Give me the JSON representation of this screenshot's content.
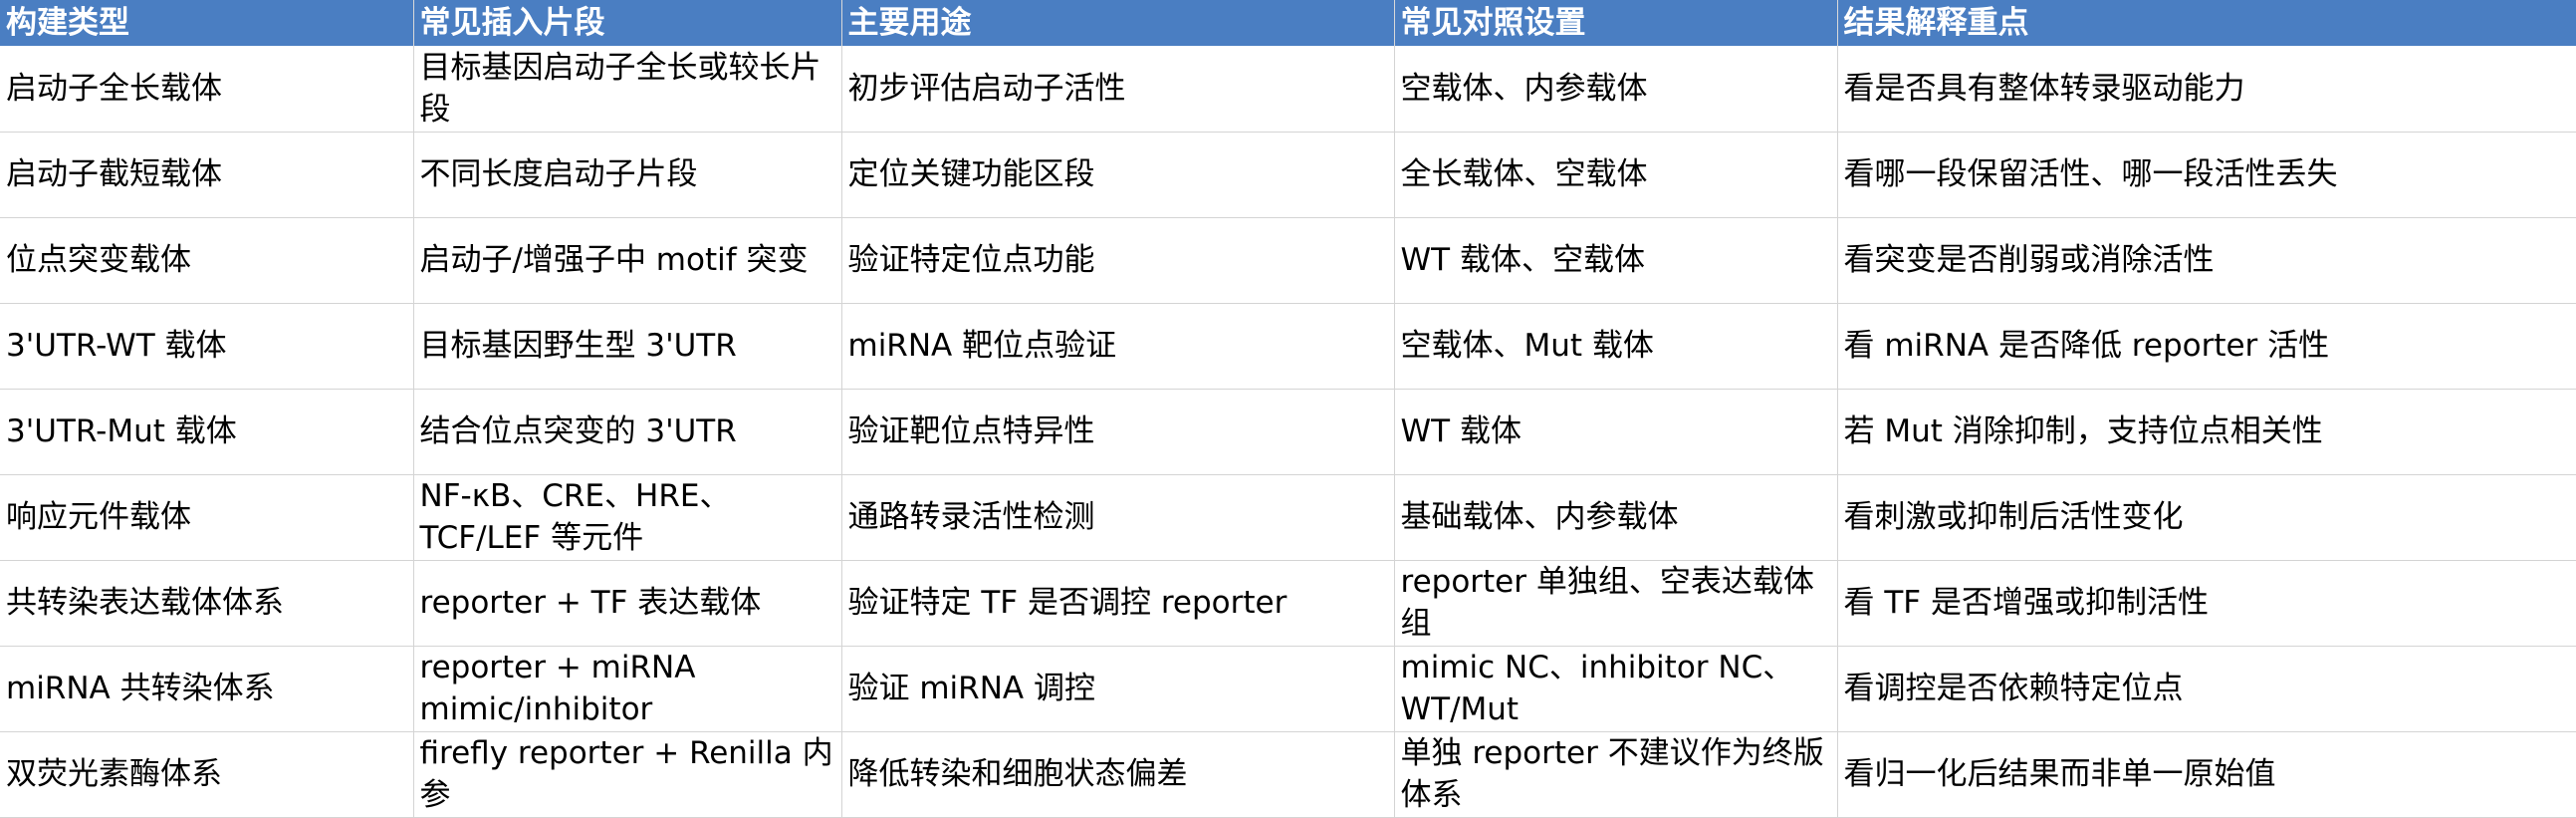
{
  "table": {
    "headers": [
      "构建类型",
      "常见插入片段",
      "主要用途",
      "常见对照设置",
      "结果解释重点"
    ],
    "rows": [
      [
        "启动子全长载体",
        "目标基因启动子全长或较长片段",
        "初步评估启动子活性",
        "空载体、内参载体",
        "看是否具有整体转录驱动能力"
      ],
      [
        "启动子截短载体",
        "不同长度启动子片段",
        "定位关键功能区段",
        "全长载体、空载体",
        "看哪一段保留活性、哪一段活性丢失"
      ],
      [
        "位点突变载体",
        "启动子/增强子中 motif 突变",
        "验证特定位点功能",
        "WT 载体、空载体",
        "看突变是否削弱或消除活性"
      ],
      [
        "3'UTR-WT 载体",
        "目标基因野生型 3'UTR",
        "miRNA 靶位点验证",
        "空载体、Mut 载体",
        "看 miRNA 是否降低 reporter 活性"
      ],
      [
        "3'UTR-Mut 载体",
        "结合位点突变的 3'UTR",
        "验证靶位点特异性",
        "WT 载体",
        "若 Mut 消除抑制，支持位点相关性"
      ],
      [
        "响应元件载体",
        "NF-κB、CRE、HRE、TCF/LEF 等元件",
        "通路转录活性检测",
        "基础载体、内参载体",
        "看刺激或抑制后活性变化"
      ],
      [
        "共转染表达载体体系",
        "reporter + TF 表达载体",
        "验证特定 TF 是否调控 reporter",
        "reporter 单独组、空表达载体组",
        "看 TF 是否增强或抑制活性"
      ],
      [
        "miRNA 共转染体系",
        "reporter + miRNA mimic/inhibitor",
        "验证 miRNA 调控",
        "mimic NC、inhibitor NC、WT/Mut",
        "看调控是否依赖特定位点"
      ],
      [
        "双荧光素酶体系",
        "firefly reporter + Renilla 内参",
        "降低转染和细胞状态偏差",
        "单独 reporter 不建议作为终版体系",
        "看归一化后结果而非单一原始值"
      ]
    ]
  }
}
